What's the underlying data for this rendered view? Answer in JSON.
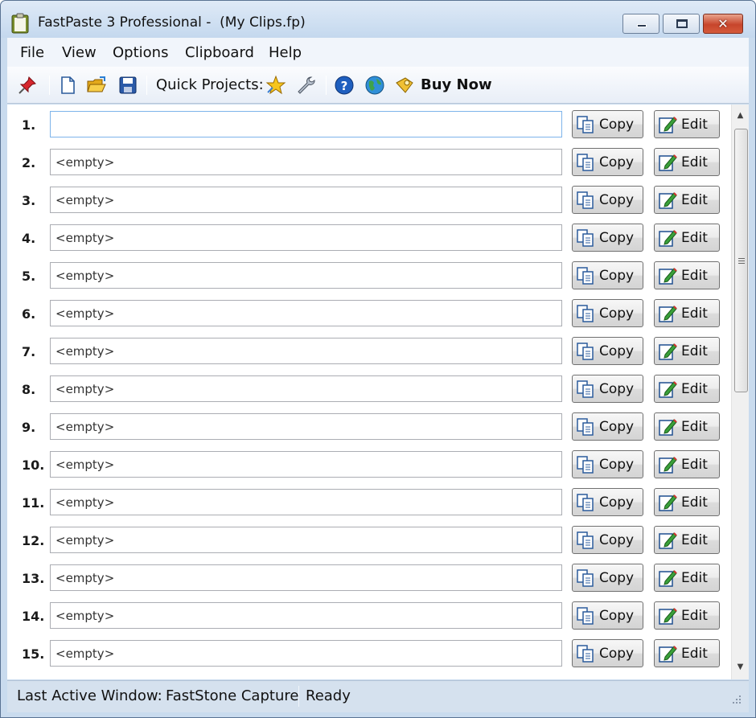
{
  "window": {
    "title": "FastPaste 3 Professional -  (My Clips.fp)",
    "caption_buttons": {
      "minimize": "minimize",
      "maximize": "maximize",
      "close": "✕"
    }
  },
  "menu": [
    {
      "label": "File"
    },
    {
      "label": "View"
    },
    {
      "label": "Options"
    },
    {
      "label": "Clipboard"
    },
    {
      "label": "Help"
    }
  ],
  "toolbar": {
    "quick_projects_label": "Quick Projects:",
    "buy_now_label": "Buy Now",
    "icons": [
      "pin-icon",
      "new-file-icon",
      "open-folder-icon",
      "save-icon",
      "star-icon",
      "wrench-icon",
      "help-icon",
      "globe-icon",
      "buy-now-icon"
    ]
  },
  "clips": [
    {
      "num": "1.",
      "value": "",
      "copy": "Copy",
      "edit": "Edit"
    },
    {
      "num": "2.",
      "value": "<empty>",
      "copy": "Copy",
      "edit": "Edit"
    },
    {
      "num": "3.",
      "value": "<empty>",
      "copy": "Copy",
      "edit": "Edit"
    },
    {
      "num": "4.",
      "value": "<empty>",
      "copy": "Copy",
      "edit": "Edit"
    },
    {
      "num": "5.",
      "value": "<empty>",
      "copy": "Copy",
      "edit": "Edit"
    },
    {
      "num": "6.",
      "value": "<empty>",
      "copy": "Copy",
      "edit": "Edit"
    },
    {
      "num": "7.",
      "value": "<empty>",
      "copy": "Copy",
      "edit": "Edit"
    },
    {
      "num": "8.",
      "value": "<empty>",
      "copy": "Copy",
      "edit": "Edit"
    },
    {
      "num": "9.",
      "value": "<empty>",
      "copy": "Copy",
      "edit": "Edit"
    },
    {
      "num": "10.",
      "value": "<empty>",
      "copy": "Copy",
      "edit": "Edit"
    },
    {
      "num": "11.",
      "value": "<empty>",
      "copy": "Copy",
      "edit": "Edit"
    },
    {
      "num": "12.",
      "value": "<empty>",
      "copy": "Copy",
      "edit": "Edit"
    },
    {
      "num": "13.",
      "value": "<empty>",
      "copy": "Copy",
      "edit": "Edit"
    },
    {
      "num": "14.",
      "value": "<empty>",
      "copy": "Copy",
      "edit": "Edit"
    },
    {
      "num": "15.",
      "value": "<empty>",
      "copy": "Copy",
      "edit": "Edit"
    }
  ],
  "status": {
    "last_active_label": "Last Active Window:",
    "last_active_value": "FastStone Capture",
    "state": "Ready"
  },
  "colors": {
    "frame": "#c9dbee",
    "menu_bg": "#f1f5fb",
    "status_bg": "#d5e1ee",
    "close_button": "#c7452c",
    "active_field_border": "#7eb4ea"
  }
}
